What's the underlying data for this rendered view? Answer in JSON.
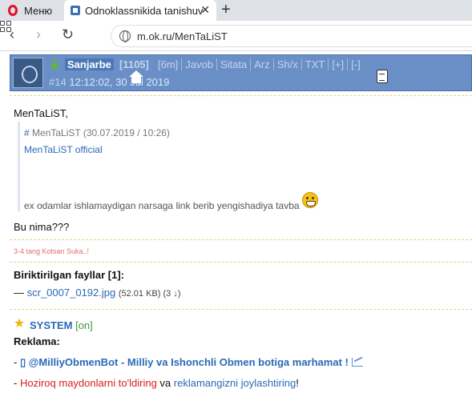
{
  "browser": {
    "menu_label": "Меню",
    "tab_title": "Odnoklassnikida tanishuv",
    "tab_close": "✕",
    "new_tab": "+",
    "url": "m.ok.ru/MenTaLiST",
    "nav": {
      "back": "‹",
      "forward": "›",
      "reload": "↻"
    }
  },
  "post_header": {
    "username": "Sanjarbe",
    "reputation": "[1105]",
    "links": [
      "[6m]",
      "Javob",
      "Sitata",
      "Arz",
      "Sh/x",
      "TXT",
      "[+]",
      "[-]"
    ],
    "post_number": "#14",
    "timestamp": "12:12:02, 30 Jul 2019"
  },
  "post": {
    "greeting": "MenTaLiST,",
    "quote": {
      "hash": "#",
      "header": "MenTaLiST (30.07.2019 / 10:26)",
      "link": "MenTaLiST official",
      "body": "ex odamlar ishlamaydigan narsaga link berib yengishadiya tavba"
    },
    "text": "Bu nima???",
    "signature": "3-4 tang Kotsan Suka..!"
  },
  "attachments": {
    "title": "Biriktirilgan fayllar [1]:",
    "dash": "—",
    "file_name": "scr_0007_0192.jpg",
    "file_meta": "(52.01 KB) (3 ↓)"
  },
  "system": {
    "star": "★",
    "name": "SYSTEM",
    "status": "[on]",
    "reklama_label": "Reklama:",
    "ad1_prefix": "- ",
    "ad1_text": "▯ @MilliyObmenBot - Milliy va Ishonchli Obmen botiga marhamat !",
    "ad2_prefix": "- ",
    "ad2_red": "Hoziroq maydonlarni to'ldiring",
    "ad2_mid": " va ",
    "ad2_blue": "reklamangizni joylashtiring",
    "ad2_end": "!"
  },
  "colors": {
    "header_bg": "#6a8fc6",
    "link_blue": "#2a6ab6",
    "signature_red": "#e56b6b",
    "ad_red": "#d62020",
    "online_green": "#3a9a3a"
  }
}
